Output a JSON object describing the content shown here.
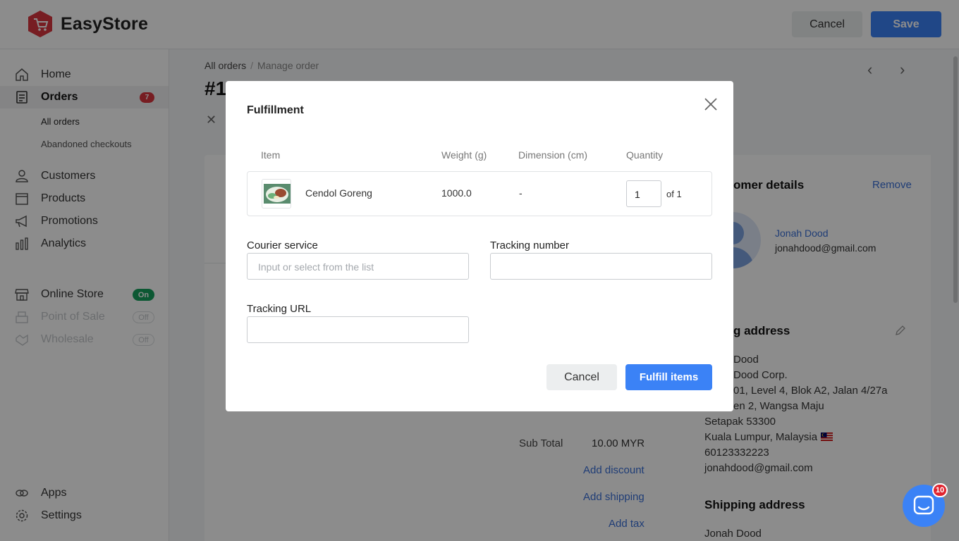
{
  "app": {
    "brand": "EasyStore"
  },
  "topbar": {
    "cancel_label": "Cancel",
    "save_label": "Save"
  },
  "sidebar": {
    "home": "Home",
    "orders": "Orders",
    "orders_badge": "7",
    "all_orders": "All orders",
    "abandoned_checkouts": "Abandoned checkouts",
    "customers": "Customers",
    "products": "Products",
    "promotions": "Promotions",
    "analytics": "Analytics",
    "online_store": "Online Store",
    "online_store_status": "On",
    "point_of_sale": "Point of Sale",
    "point_of_sale_status": "Off",
    "wholesale": "Wholesale",
    "wholesale_status": "Off",
    "apps": "Apps",
    "settings": "Settings"
  },
  "page": {
    "breadcrumb_root": "All orders",
    "breadcrumb_sep": "/",
    "breadcrumb_current": "Manage order",
    "order_title": "#1",
    "sub_total_label": "Sub Total",
    "sub_total_value": "10.00 MYR",
    "add_discount": "Add discount",
    "add_shipping": "Add shipping",
    "add_tax": "Add tax"
  },
  "customer": {
    "title": "omer details",
    "remove": "Remove",
    "name": "Jonah Dood",
    "email": "jonahdood@gmail.com",
    "billing_title": "g address",
    "billing_lines": [
      "Dood",
      "Dood Corp.",
      "01, Level 4, Blok A2, Jalan 4/27a",
      "en 2, Wangsa Maju",
      "Setapak 53300",
      "Kuala Lumpur, Malaysia",
      "60123332223",
      "jonahdood@gmail.com"
    ],
    "shipping_title": "Shipping address",
    "shipping_name": "Jonah Dood"
  },
  "chat": {
    "count": "10"
  },
  "modal": {
    "title": "Fulfillment",
    "col_item": "Item",
    "col_weight": "Weight (g)",
    "col_dimension": "Dimension (cm)",
    "col_quantity": "Quantity",
    "item_name": "Cendol Goreng",
    "item_weight": "1000.0",
    "item_dimension": "-",
    "item_quantity": "1",
    "item_quantity_of": "of 1",
    "courier_label": "Courier service",
    "courier_placeholder": "Input or select from the list",
    "tracking_number_label": "Tracking number",
    "tracking_url_label": "Tracking URL",
    "cancel_label": "Cancel",
    "fulfill_label": "Fulfill items"
  },
  "colors": {
    "primary": "#3b82f6",
    "brand_red": "#d9363e",
    "on_green": "#17a05d"
  }
}
